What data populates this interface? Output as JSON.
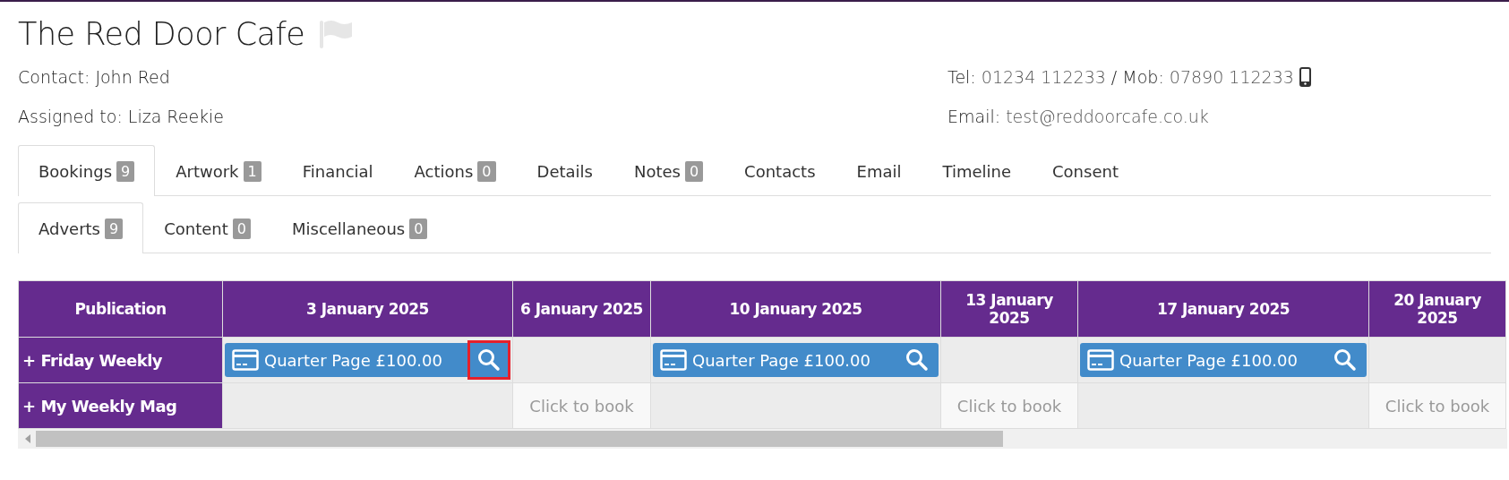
{
  "header": {
    "title": "The Red Door Cafe",
    "contact_label": "Contact:",
    "contact": "John Red",
    "assigned_label": "Assigned to:",
    "assigned": "Liza Reekie",
    "tel_label": "Tel:",
    "tel": "01234 112233",
    "separator": "/",
    "mob_label": "Mob:",
    "mob": "07890 112233",
    "email_label": "Email:",
    "email": "test@reddoorcafe.co.uk"
  },
  "tabs": [
    {
      "label": "Bookings",
      "count": "9",
      "selected": true
    },
    {
      "label": "Artwork",
      "count": "1",
      "selected": false
    },
    {
      "label": "Financial",
      "selected": false
    },
    {
      "label": "Actions",
      "count": "0",
      "selected": false
    },
    {
      "label": "Details",
      "selected": false
    },
    {
      "label": "Notes",
      "count": "0",
      "selected": false
    },
    {
      "label": "Contacts",
      "selected": false
    },
    {
      "label": "Email",
      "selected": false
    },
    {
      "label": "Timeline",
      "selected": false
    },
    {
      "label": "Consent",
      "selected": false
    }
  ],
  "subtabs": [
    {
      "label": "Adverts",
      "count": "9",
      "selected": true
    },
    {
      "label": "Content",
      "count": "0",
      "selected": false
    },
    {
      "label": "Miscellaneous",
      "count": "0",
      "selected": false
    }
  ],
  "table": {
    "columns": [
      "Publication",
      "3 January 2025",
      "6 January 2025",
      "10 January 2025",
      "13 January 2025",
      "17 January 2025",
      "20 January 2025"
    ],
    "rows": [
      {
        "cells": [
          {
            "kind": "publication",
            "expand_icon": "+",
            "label": "Friday Weekly"
          },
          {
            "kind": "booking",
            "label": "Quarter Page £100.00",
            "highlighted": true
          },
          {
            "kind": "empty"
          },
          {
            "kind": "booking",
            "label": "Quarter Page £100.00",
            "highlighted": false
          },
          {
            "kind": "empty"
          },
          {
            "kind": "booking",
            "label": "Quarter Page £100.00",
            "highlighted": false
          },
          {
            "kind": "empty"
          }
        ]
      },
      {
        "cells": [
          {
            "kind": "publication",
            "expand_icon": "+",
            "label": "My Weekly Mag"
          },
          {
            "kind": "empty"
          },
          {
            "kind": "bookable",
            "label": "Click to book"
          },
          {
            "kind": "empty"
          },
          {
            "kind": "bookable",
            "label": "Click to book"
          },
          {
            "kind": "empty"
          },
          {
            "kind": "bookable",
            "label": "Click to book"
          }
        ]
      }
    ]
  }
}
